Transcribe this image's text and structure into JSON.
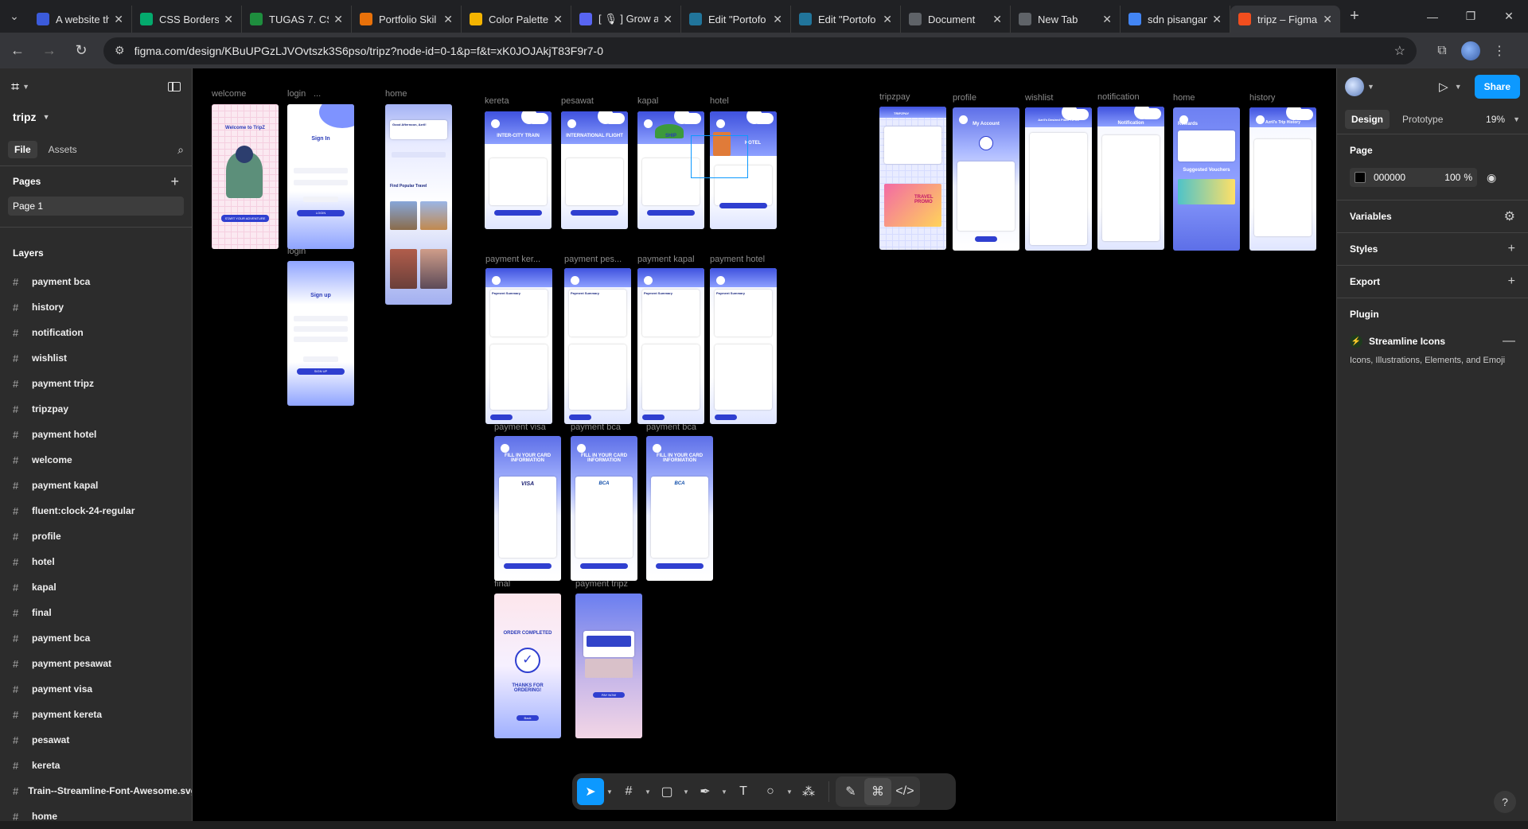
{
  "browser": {
    "tabs": [
      {
        "title": "A website th",
        "favicon": "W-blue",
        "color": "#3b5bdb"
      },
      {
        "title": "CSS Borders",
        "favicon": "W-green",
        "color": "#04aa6d"
      },
      {
        "title": "TUGAS 7. CS",
        "favicon": "classroom",
        "color": "#1e8e3e"
      },
      {
        "title": "Portfolio Skil",
        "favicon": "sun",
        "color": "#e8710a"
      },
      {
        "title": "Color Palette",
        "favicon": "palette",
        "color": "#f4b400"
      },
      {
        "title": "[ 🎙 ] Grow a",
        "favicon": "discord",
        "color": "#5865f2"
      },
      {
        "title": "Edit \"Portofo",
        "favicon": "wordpress",
        "color": "#21759b"
      },
      {
        "title": "Edit \"Portofo",
        "favicon": "wordpress",
        "color": "#21759b"
      },
      {
        "title": "Document",
        "favicon": "globe",
        "color": "#5f6368"
      },
      {
        "title": "New Tab",
        "favicon": "chrome",
        "color": "#5f6368"
      },
      {
        "title": "sdn pisangan",
        "favicon": "google",
        "color": "#4285f4"
      },
      {
        "title": "tripz – Figma",
        "favicon": "figma",
        "color": "#f24e1e",
        "active": true
      }
    ],
    "url_site_icon": "tune-icon",
    "url": "figma.com/design/KBuUPGzLJVOvtszk3S6pso/tripz?node-id=0-1&p=f&t=xK0JOJAkjT83F9r7-0"
  },
  "left_panel": {
    "project": "tripz",
    "tabs": [
      "File",
      "Assets"
    ],
    "pages_heading": "Pages",
    "pages": [
      "Page 1"
    ],
    "layers_heading": "Layers",
    "layers": [
      "payment bca",
      "history",
      "notification",
      "wishlist",
      "payment tripz",
      "tripzpay",
      "payment hotel",
      "welcome",
      "payment kapal",
      "fluent:clock-24-regular",
      "profile",
      "hotel",
      "kapal",
      "final",
      "payment bca",
      "payment pesawat",
      "payment visa",
      "payment kereta",
      "pesawat",
      "kereta",
      "Train--Streamline-Font-Awesome.svg",
      "home"
    ]
  },
  "canvas": {
    "labels": {
      "welcome": "welcome",
      "login": "login",
      "login_dots": "...",
      "login2": "login",
      "home": "home",
      "kereta": "kereta",
      "pesawat": "pesawat",
      "kapal": "kapal",
      "hotel": "hotel",
      "payment_kereta": "payment ker...",
      "payment_pesawat": "payment pes...",
      "payment_kapal": "payment kapal",
      "payment_hotel": "payment hotel",
      "payment_visa": "payment visa",
      "payment_bca1": "payment bca",
      "payment_bca2": "payment bca",
      "final": "final",
      "payment_tripz": "payment tripz",
      "tripzpay": "tripzpay",
      "profile": "profile",
      "wishlist": "wishlist",
      "notification": "notification",
      "home2": "home",
      "history": "history"
    },
    "frame_text": {
      "welcome_title": "Welcome to TripZ",
      "welcome_btn": "START YOUR ADVENTURE",
      "signin": "Sign In",
      "login_btn": "LOGIN",
      "signup": "Sign up",
      "signup_btn": "SIGN UP",
      "home_greet": "Good Afternoon, Azril!",
      "home_popular": "Find Popular Travel",
      "kereta_title": "INTER-CITY TRAIN",
      "pesawat_title": "INTERNATIONAL FLIGHT",
      "kapal_title": "SHIP",
      "hotel_title": "HOTEL",
      "payment_summary": "Payment Summary",
      "fill_card": "FILL IN YOUR CARD INFORMATION",
      "visa": "VISA",
      "bca": "BCA",
      "order_completed": "ORDER COMPLETED",
      "thanks": "THANKS FOR ORDERING!",
      "back": "Back",
      "tripzpay_title": "TRIPZPAY",
      "promo": "TRAVEL PROMO",
      "my_account": "My Account",
      "wishlist_title": "Azril's Desired Place To Go",
      "notification_title": "Notification",
      "rewards": "Rewards",
      "vouchers": "Suggested Vouchers",
      "history_title": "Azril's Trip History",
      "pay_now": "PAY NOW"
    }
  },
  "toolbar": {
    "tools": [
      "move-tool",
      "frame-tool",
      "shape-tool",
      "pen-tool",
      "text-tool",
      "comment-tool",
      "actions-tool"
    ],
    "modes": [
      "draw-mode",
      "design-mode",
      "dev-mode"
    ]
  },
  "right_panel": {
    "share": "Share",
    "tabs": [
      "Design",
      "Prototype"
    ],
    "zoom": "19%",
    "page_heading": "Page",
    "page_color": "000000",
    "page_opacity": "100",
    "percent": "%",
    "variables": "Variables",
    "styles": "Styles",
    "export": "Export",
    "plugin_heading": "Plugin",
    "plugin_name": "Streamline Icons",
    "plugin_desc": "Icons, Illustrations, Elements, and Emoji",
    "help": "?"
  }
}
